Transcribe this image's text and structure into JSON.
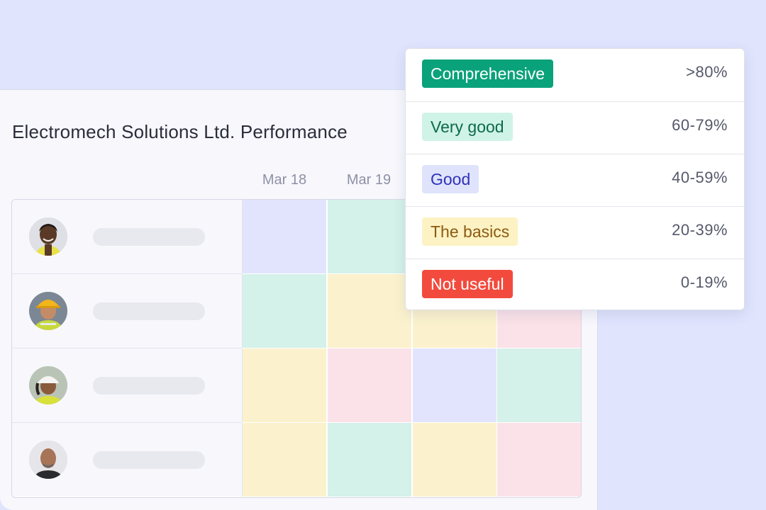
{
  "card": {
    "title": "Electromech Solutions Ltd. Performance",
    "columns": [
      "Mar 18",
      "Mar 19"
    ]
  },
  "rows": [
    {
      "cells": [
        "good",
        "very_good",
        "",
        ""
      ]
    },
    {
      "cells": [
        "very_good",
        "the_basics",
        "the_basics",
        "not_useful"
      ]
    },
    {
      "cells": [
        "the_basics",
        "not_useful",
        "good",
        "very_good"
      ]
    },
    {
      "cells": [
        "the_basics",
        "very_good",
        "the_basics",
        "not_useful"
      ]
    }
  ],
  "cell_colors": {
    "comprehensive": "#0aa27a",
    "very_good": "#d4f1ea",
    "good": "#e1e4fc",
    "the_basics": "#fbf2cd",
    "not_useful": "#fbe2e8"
  },
  "legend": [
    {
      "label": "Comprehensive",
      "range": ">80%",
      "bg": "#0aa27a",
      "fg": "#ffffff"
    },
    {
      "label": "Very good",
      "range": "60-79%",
      "bg": "#d0f3e7",
      "fg": "#0c6a4b"
    },
    {
      "label": "Good",
      "range": "40-59%",
      "bg": "#dfe3fc",
      "fg": "#2f33b8"
    },
    {
      "label": "The basics",
      "range": "20-39%",
      "bg": "#fdf2c4",
      "fg": "#8b5a10"
    },
    {
      "label": "Not useful",
      "range": "0-19%",
      "bg": "#f24b3e",
      "fg": "#ffffff"
    }
  ]
}
